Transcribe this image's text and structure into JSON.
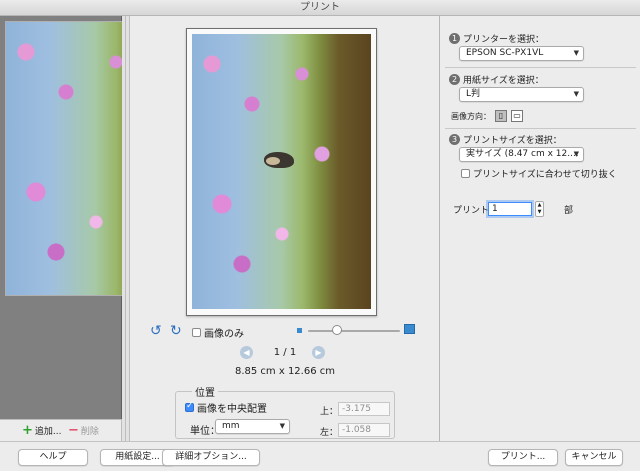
{
  "window": {
    "title": "プリント"
  },
  "thumbnails": {
    "add_label": "追加...",
    "delete_label": "削除"
  },
  "preview": {
    "image_only_label": "画像のみ",
    "image_only_checked": false,
    "page_indicator": "1 / 1",
    "dimensions": "8.85 cm x 12.66 cm",
    "zoom_level": 0.1
  },
  "position": {
    "legend": "位置",
    "center_label": "画像を中央配置",
    "center_checked": true,
    "unit_label": "単位：",
    "unit_value": "mm",
    "top_label": "上：",
    "top_value": "-3.175",
    "left_label": "左：",
    "left_value": "-1.058"
  },
  "settings": {
    "step1": {
      "num": "1",
      "label": "プリンターを選択：",
      "value": "EPSON SC-PX1VL"
    },
    "step2": {
      "num": "2",
      "label": "用紙サイズを選択：",
      "value": "L判",
      "orientation_label": "画像方向："
    },
    "step3": {
      "num": "3",
      "label": "プリントサイズを選択：",
      "value": "実サイズ (8.47 cm x 12....",
      "crop_label": "プリントサイズに合わせて切り抜く",
      "crop_checked": false
    },
    "copies_label": "プリント",
    "copies_value": "1",
    "copies_unit": "部"
  },
  "buttons": {
    "help": "ヘルプ",
    "page_setup": "用紙設定...",
    "detail_options": "詳細オプション...",
    "print": "プリント...",
    "cancel": "キャンセル"
  },
  "colors": {
    "accent": "#3d8bfd",
    "thumbnail_bg": "#808080",
    "window_bg": "#ececec"
  }
}
